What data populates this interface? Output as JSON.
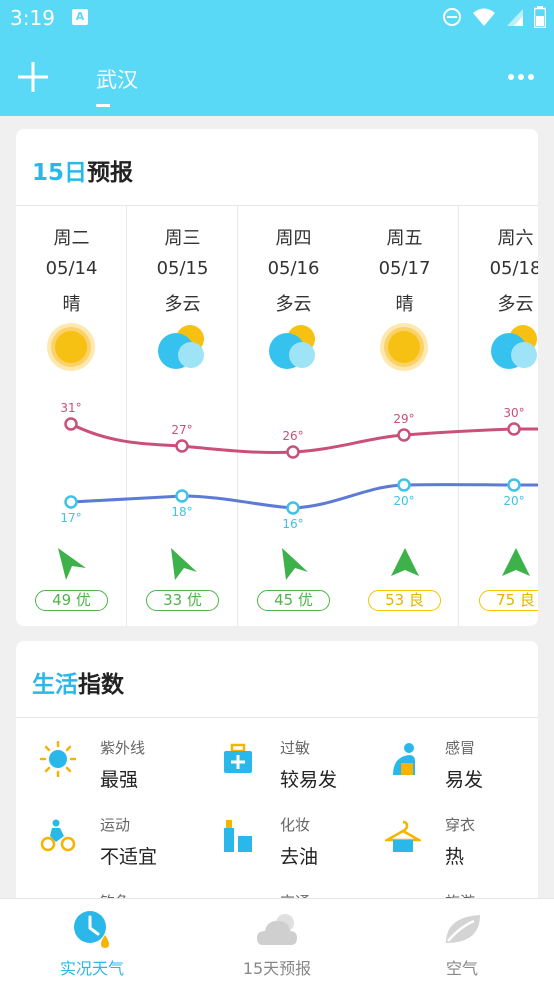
{
  "status": {
    "time": "3:19"
  },
  "header": {
    "city": "武汉"
  },
  "forecast": {
    "title_accent": "15日",
    "title_rest": "预报",
    "days": [
      {
        "dow": "周二",
        "date": "05/14",
        "cond": "晴",
        "icon": "sun-icon",
        "high": "31°",
        "low": "17°",
        "aqi": "49 优",
        "aqi_level": "good"
      },
      {
        "dow": "周三",
        "date": "05/15",
        "cond": "多云",
        "icon": "cloudy-icon",
        "high": "27°",
        "low": "18°",
        "aqi": "33 优",
        "aqi_level": "good"
      },
      {
        "dow": "周四",
        "date": "05/16",
        "cond": "多云",
        "icon": "cloudy-icon",
        "high": "26°",
        "low": "16°",
        "aqi": "45 优",
        "aqi_level": "good"
      },
      {
        "dow": "周五",
        "date": "05/17",
        "cond": "晴",
        "icon": "sun-icon",
        "high": "29°",
        "low": "20°",
        "aqi": "53 良",
        "aqi_level": "moderate"
      },
      {
        "dow": "周六",
        "date": "05/18",
        "cond": "多云",
        "icon": "cloudy-icon",
        "high": "30°",
        "low": "20°",
        "aqi": "75 良",
        "aqi_level": "moderate"
      }
    ]
  },
  "life": {
    "title_accent": "生活",
    "title_rest": "指数",
    "items": [
      {
        "name": "紫外线",
        "value": "最强",
        "icon": "uv-sun-icon"
      },
      {
        "name": "过敏",
        "value": "较易发",
        "icon": "medkit-icon"
      },
      {
        "name": "感冒",
        "value": "易发",
        "icon": "cold-person-icon"
      },
      {
        "name": "运动",
        "value": "不适宜",
        "icon": "cycling-icon"
      },
      {
        "name": "化妆",
        "value": "去油",
        "icon": "makeup-icon"
      },
      {
        "name": "穿衣",
        "value": "热",
        "icon": "clothes-hanger-icon"
      },
      {
        "name": "钓鱼",
        "value": "",
        "icon": ""
      },
      {
        "name": "交通",
        "value": "",
        "icon": ""
      },
      {
        "name": "旅游",
        "value": "",
        "icon": ""
      }
    ]
  },
  "nav": {
    "items": [
      {
        "label": "实况天气",
        "icon": "clock-drop-icon",
        "active": true
      },
      {
        "label": "15天预报",
        "icon": "cloud-icon",
        "active": false
      },
      {
        "label": "空气",
        "icon": "leaf-icon",
        "active": false
      }
    ]
  },
  "colors": {
    "accent": "#5ad9f7",
    "title_accent": "#2ab8ea",
    "high_line": "#c9507a",
    "low_line": "#5d7bd6",
    "low_point": "#3ec3e6",
    "aqi_good": "#4cb548",
    "aqi_moderate": "#f3c400"
  }
}
